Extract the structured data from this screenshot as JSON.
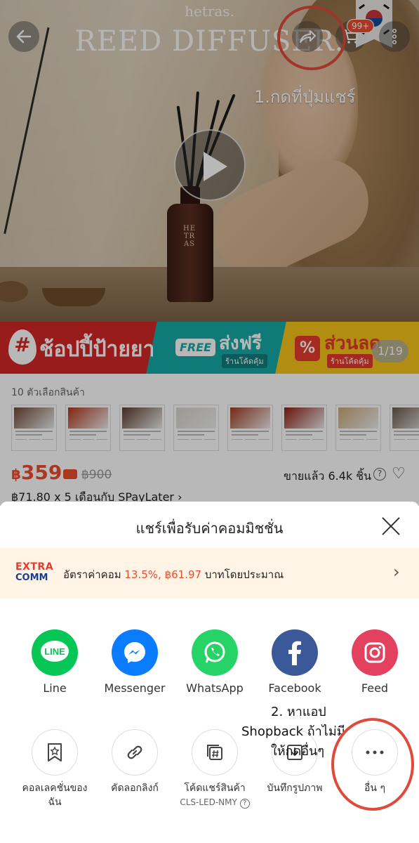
{
  "hero": {
    "brand_small": "hetras.",
    "brand_big": "REED DIFFUSER.",
    "bottle_label": "HE\nTR\nAS",
    "cart_badge": "99+",
    "image_counter": "1/19"
  },
  "annotations": {
    "step1": "1.กดที่ปุ่มแชร์",
    "step2_line1": "2. หาแอป",
    "step2_line2": "Shopback  ถ้าไม่มี",
    "step2_line3": "ให้กดอื่นๆ"
  },
  "promo": {
    "title1": "ช้อปปี้ป้ายยา",
    "free_tag": "FREE",
    "title2": "ส่งฟรี",
    "sub2": "ร้านโค้ดคุ้ม",
    "pct": "%",
    "title3": "ส่วนลด",
    "sub3": "ร้านโค้ดคุ้ม"
  },
  "product": {
    "options_label": "10 ตัวเลือกสินค้า",
    "thumb_count": 8,
    "price_currency": "฿",
    "price_value": "359",
    "old_price": "฿900",
    "sold": "ขายแล้ว 6.4k ชิ้น",
    "installment": "฿71.80 x 5 เดือนกับ SPayLater ›"
  },
  "share_sheet": {
    "title": "แชร์เพื่อรับค่าคอมมิชชั่น",
    "extra_logo_1": "EXTRA",
    "extra_logo_2": "COMM",
    "commission_prefix": "อัตราค่าคอม ",
    "commission_rate": "13.5%, ฿61.97",
    "commission_suffix": " บาทโดยประมาณ",
    "apps": [
      {
        "label": "Line",
        "color": "#06c755",
        "icon": "line-icon"
      },
      {
        "label": "Messenger",
        "color": "#0a7cff",
        "icon": "messenger-icon"
      },
      {
        "label": "WhatsApp",
        "color": "#25d366",
        "icon": "whatsapp-icon"
      },
      {
        "label": "Facebook",
        "color": "#3b5998",
        "icon": "facebook-icon"
      },
      {
        "label": "Feed",
        "color": "#e4405f",
        "icon": "instagram-icon"
      }
    ],
    "actions": [
      {
        "label": "คอลเลคชั่นของฉัน",
        "icon": "bookmark-star-icon"
      },
      {
        "label": "คัดลอกลิงก์",
        "icon": "link-icon"
      },
      {
        "label": "โค้ดแชร์สินค้า",
        "sub": "CLS-LED-NMY",
        "icon": "hash-code-icon"
      },
      {
        "label": "บันทึกรูปภาพ",
        "icon": "save-image-icon"
      },
      {
        "label": "อื่น ๆ",
        "icon": "more-dots-icon"
      }
    ]
  }
}
